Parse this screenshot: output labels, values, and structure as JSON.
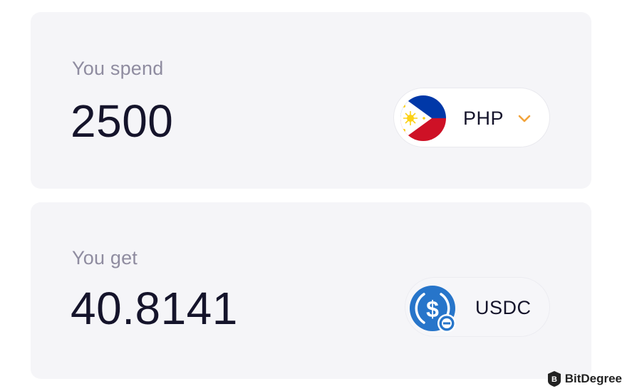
{
  "spend": {
    "label": "You spend",
    "amount": "2500",
    "currency": "PHP",
    "icon": "philippines-flag-icon"
  },
  "get": {
    "label": "You get",
    "amount": "40.8141",
    "currency": "USDC",
    "icon": "usdc-coin-icon"
  },
  "watermark": {
    "text": "BitDegree"
  },
  "colors": {
    "card_background": "#f5f5f8",
    "label": "#8f8ca0",
    "amount": "#15142b",
    "chevron": "#f2a33a",
    "usdc_blue": "#2775ca"
  }
}
